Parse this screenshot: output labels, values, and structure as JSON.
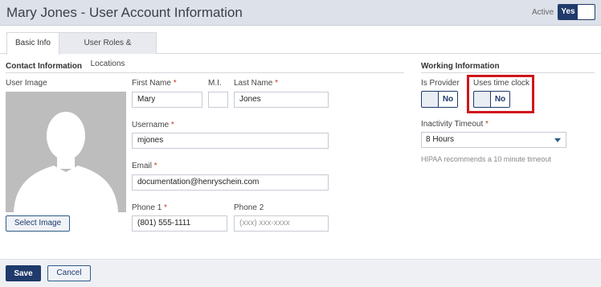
{
  "header": {
    "title": "Mary Jones - User Account Information",
    "active_label": "Active",
    "active_toggle": "Yes"
  },
  "tabs": [
    {
      "label": "Basic Info",
      "selected": true
    },
    {
      "label": "User Roles & Locations",
      "selected": false
    }
  ],
  "contact": {
    "section_title": "Contact Information",
    "user_image_label": "User Image",
    "select_image_label": "Select Image",
    "first_name": {
      "label": "First Name",
      "required_mark": "*",
      "value": "Mary"
    },
    "middle_initial": {
      "label": "M.I.",
      "value": ""
    },
    "last_name": {
      "label": "Last Name",
      "required_mark": "*",
      "value": "Jones"
    },
    "username": {
      "label": "Username",
      "required_mark": "*",
      "value": "mjones"
    },
    "email": {
      "label": "Email",
      "required_mark": "*",
      "value": "documentation@henryschein.com"
    },
    "phone1": {
      "label": "Phone 1",
      "required_mark": "*",
      "value": "(801) 555-1111"
    },
    "phone2": {
      "label": "Phone 2",
      "placeholder": "(xxx) xxx-xxxx"
    }
  },
  "working": {
    "section_title": "Working Information",
    "is_provider": {
      "label": "Is Provider",
      "toggle": "No"
    },
    "uses_time_clock": {
      "label": "Uses time clock",
      "toggle": "No"
    },
    "inactivity_timeout": {
      "label": "Inactivity Timeout",
      "required_mark": "*",
      "value": "8 Hours"
    },
    "hint": "HIPAA recommends a 10 minute timeout"
  },
  "footer": {
    "save_label": "Save",
    "cancel_label": "Cancel"
  },
  "colors": {
    "brand_navy": "#1f3a6b",
    "header_bg": "#dde1e9",
    "highlight_red": "#d0151b",
    "required_red": "#c0392b"
  }
}
